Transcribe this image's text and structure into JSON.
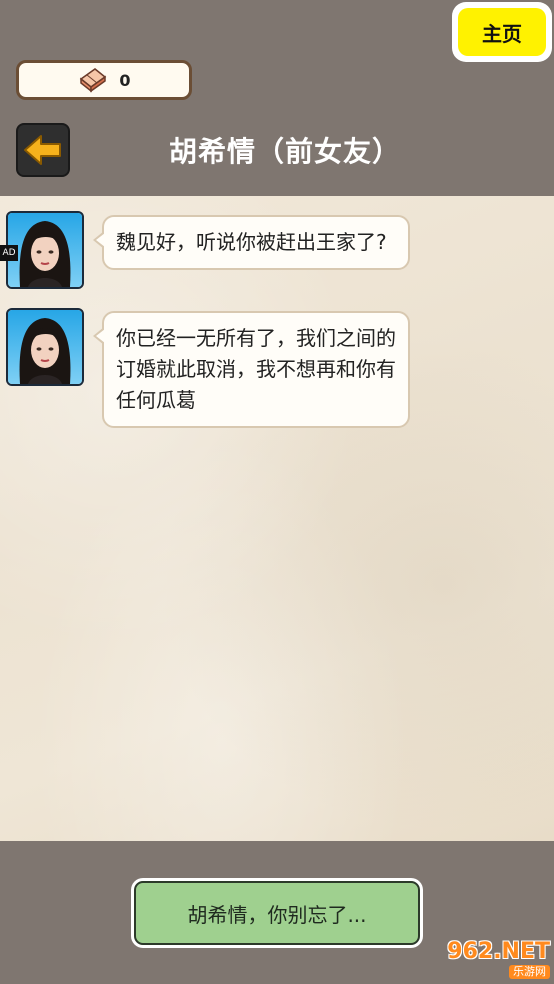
{
  "header": {
    "home_label": "主页",
    "currency_count": "0",
    "title": "胡希情（前女友）"
  },
  "chat": {
    "ad_label": "AD",
    "messages": [
      {
        "text": "魏见好，听说你被赶出王家了?"
      },
      {
        "text": "你已经一无所有了，我们之间的订婚就此取消，我不想再和你有任何瓜葛"
      }
    ]
  },
  "choices": [
    {
      "label": "胡希情，你别忘了..."
    }
  ],
  "watermark": {
    "brand": "962.NET",
    "subtitle": "乐游网"
  },
  "colors": {
    "header_bg": "#7f7670",
    "home_button": "#fff200",
    "chat_bg": "#ede4d4",
    "choice_button": "#9fd08f"
  },
  "icons": {
    "currency": "eraser-gem-icon",
    "back": "left-arrow-icon"
  }
}
